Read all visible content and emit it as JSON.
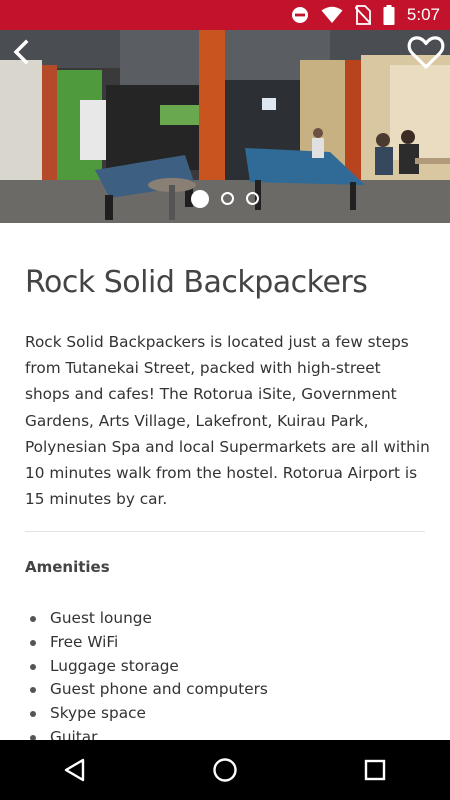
{
  "status_bar": {
    "time": "5:07",
    "icons": [
      "do-not-disturb-icon",
      "wifi-icon",
      "no-sim-icon",
      "battery-icon"
    ],
    "background_color": "#c3122c"
  },
  "hero": {
    "image_description_icons": [
      "back-arrow-icon",
      "heart-outline-icon"
    ],
    "carousel_page_count": 3,
    "carousel_active_index": 0
  },
  "listing": {
    "title": "Rock Solid Backpackers",
    "description": "Rock Solid Backpackers is located just a few steps from Tutanekai Street, packed with high-street shops and cafes! The Rotorua iSite, Government Gardens, Arts Village, Lakefront, Kuirau Park, Polynesian Spa and local Supermarkets are all within 10 minutes walk from the hostel. Rotorua Airport is 15 minutes by car."
  },
  "amenities": {
    "heading": "Amenities",
    "items": [
      "Guest lounge",
      "Free WiFi",
      "Luggage storage",
      "Guest phone and computers",
      "Skype space",
      "Guitar"
    ]
  },
  "nav_bar": {
    "icons": [
      "back-triangle-icon",
      "home-circle-icon",
      "recents-square-icon"
    ]
  }
}
